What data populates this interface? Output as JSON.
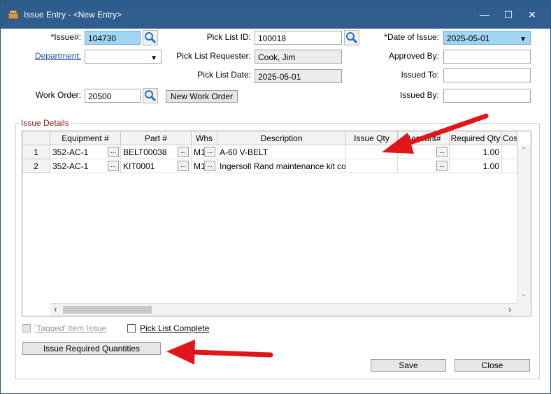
{
  "window": {
    "title": "Issue Entry - <New Entry>",
    "minimize": "—",
    "maximize": "☐",
    "close": "✕"
  },
  "form": {
    "issue_no_label": "*Issue#:",
    "issue_no": "104730",
    "department_label": "Department:",
    "department": "",
    "work_order_label": "Work Order:",
    "work_order": "20500",
    "new_work_order_label": "New Work Order",
    "pick_list_id_label": "Pick List ID:",
    "pick_list_id": "100018",
    "pick_list_requester_label": "Pick List Requester:",
    "pick_list_requester": "Cook, Jim",
    "pick_list_date_label": "Pick List Date:",
    "pick_list_date": "2025-05-01",
    "date_of_issue_label": "*Date of Issue:",
    "date_of_issue": "2025-05-01",
    "approved_by_label": "Approved By:",
    "approved_by": "",
    "issued_to_label": "Issued To:",
    "issued_to": "",
    "issued_by_label": "Issued By:",
    "issued_by": ""
  },
  "details": {
    "group_title": "Issue Details",
    "columns": [
      "Equipment #",
      "Part #",
      "Whs",
      "Description",
      "Issue Qty",
      "Account#",
      "Required Qty",
      "Cost"
    ],
    "rows": [
      {
        "num": "1",
        "equipment": "352-AC-1",
        "part": "BELT00038",
        "whs": "M1",
        "description": "A-60 V-BELT",
        "issue_qty": "",
        "account": "",
        "required_qty": "1.00"
      },
      {
        "num": "2",
        "equipment": "352-AC-1",
        "part": "KIT0001",
        "whs": "M1",
        "description": "Ingersoll Rand maintenance kit cor",
        "issue_qty": "",
        "account": "",
        "required_qty": "1.00"
      }
    ],
    "ellipsis": "..."
  },
  "footer": {
    "tagged_label": "'Tagged' item Issue",
    "pick_complete_label": "Pick List Complete",
    "issue_required_label": "Issue Required Quantities",
    "save_label": "Save",
    "close_label": "Close"
  },
  "colors": {
    "title_bar": "#2f5e8e",
    "highlight_field": "#9fd6f5",
    "annotation_arrow": "#e0161b"
  }
}
